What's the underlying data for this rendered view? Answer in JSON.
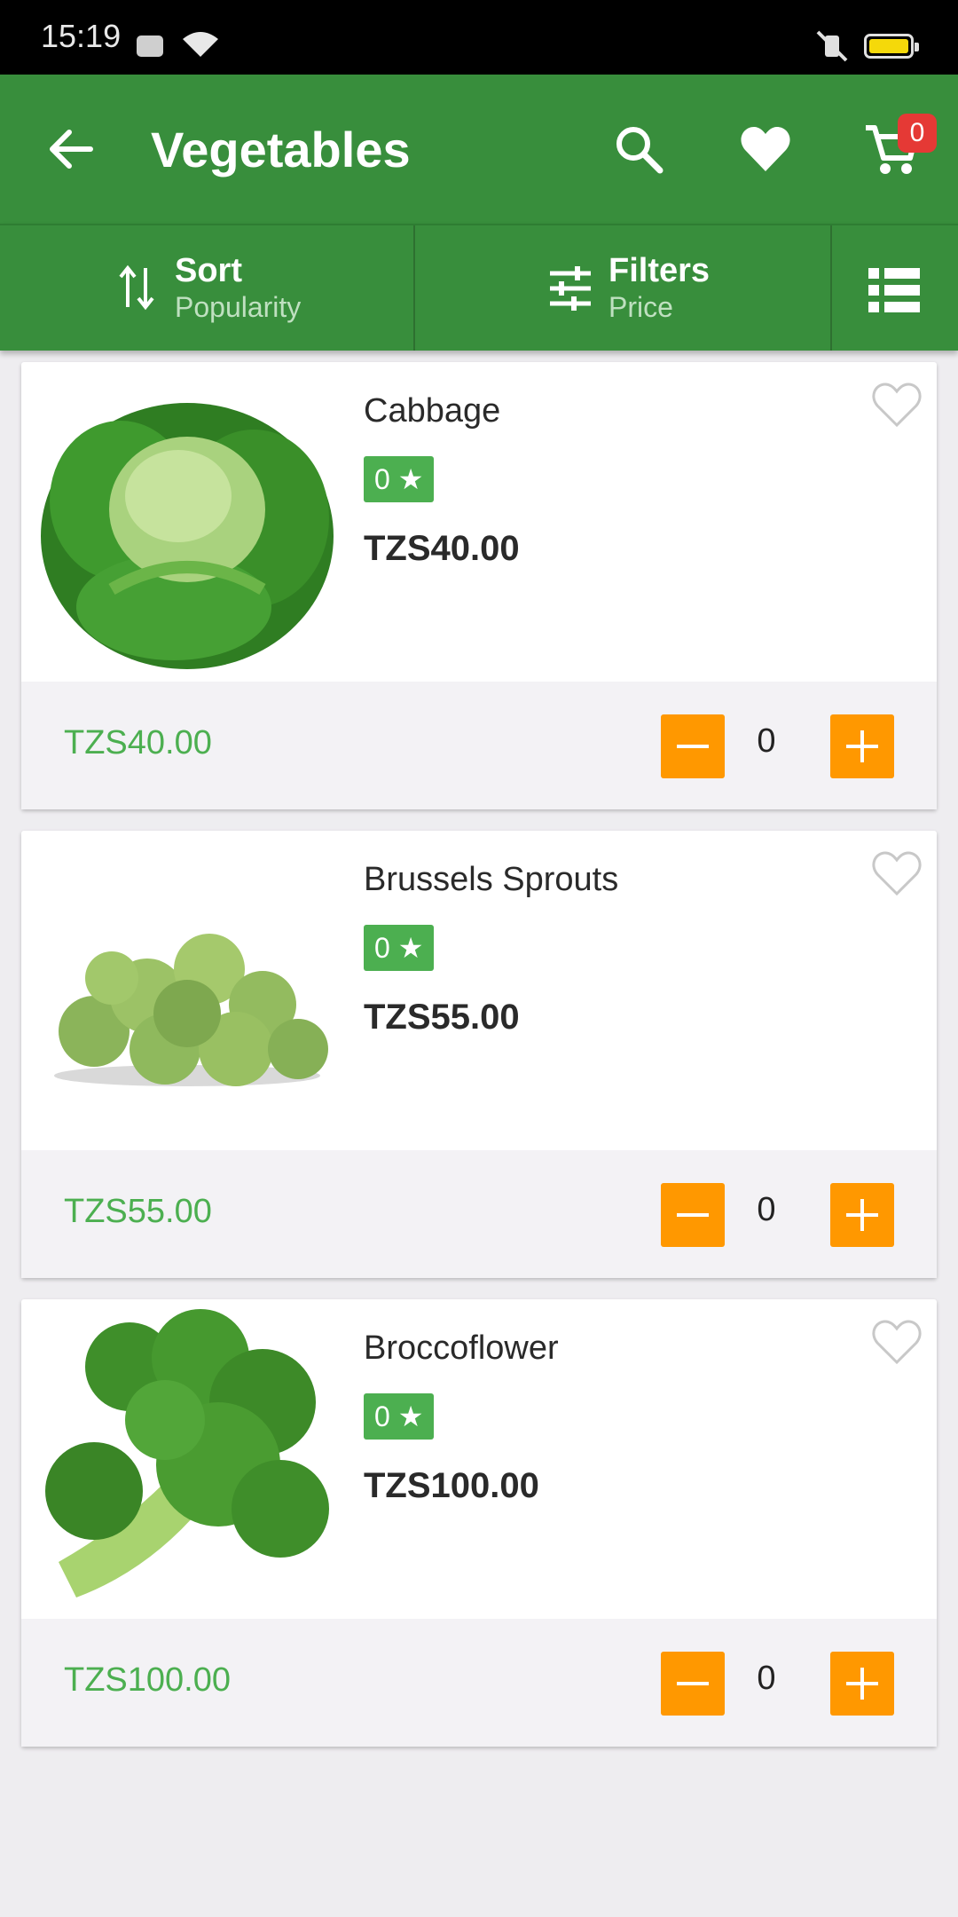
{
  "status_bar": {
    "time": "15:19"
  },
  "app_bar": {
    "title": "Vegetables",
    "cart_count": "0"
  },
  "sub_bar": {
    "sort_label": "Sort",
    "sort_value": "Popularity",
    "filter_label": "Filters",
    "filter_value": "Price"
  },
  "products": [
    {
      "name": "Cabbage",
      "rating": "0 ★",
      "price": "TZS40.00",
      "footer_price": "TZS40.00",
      "quantity": "0"
    },
    {
      "name": "Brussels Sprouts",
      "rating": "0 ★",
      "price": "TZS55.00",
      "footer_price": "TZS55.00",
      "quantity": "0"
    },
    {
      "name": "Broccoflower",
      "rating": "0 ★",
      "price": "TZS100.00",
      "footer_price": "TZS100.00",
      "quantity": "0"
    }
  ],
  "colors": {
    "primary": "#388e3c",
    "accent": "#ff9800",
    "rating_badge": "#4caf50",
    "cart_badge": "#e53935"
  }
}
